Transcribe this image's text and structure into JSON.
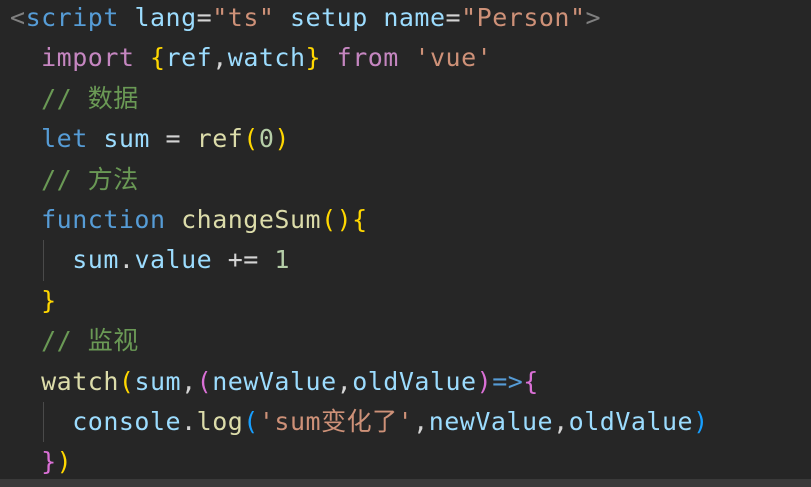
{
  "editor": {
    "lines": [
      {
        "tokens": [
          {
            "t": "<",
            "c": "tag-bracket"
          },
          {
            "t": "script",
            "c": "tag-name"
          },
          {
            "t": " ",
            "c": "punct"
          },
          {
            "t": "lang",
            "c": "attr-name"
          },
          {
            "t": "=",
            "c": "attr-eq"
          },
          {
            "t": "\"ts\"",
            "c": "string"
          },
          {
            "t": " ",
            "c": "punct"
          },
          {
            "t": "setup",
            "c": "attr-name"
          },
          {
            "t": " ",
            "c": "punct"
          },
          {
            "t": "name",
            "c": "attr-name"
          },
          {
            "t": "=",
            "c": "attr-eq"
          },
          {
            "t": "\"Person\"",
            "c": "string"
          },
          {
            "t": ">",
            "c": "tag-bracket"
          }
        ]
      },
      {
        "tokens": [
          {
            "t": "  ",
            "c": "punct"
          },
          {
            "t": "import",
            "c": "keyword-flow"
          },
          {
            "t": " ",
            "c": "punct"
          },
          {
            "t": "{",
            "c": "brace1"
          },
          {
            "t": "ref",
            "c": "variable"
          },
          {
            "t": ",",
            "c": "punct"
          },
          {
            "t": "watch",
            "c": "variable"
          },
          {
            "t": "}",
            "c": "brace1"
          },
          {
            "t": " ",
            "c": "punct"
          },
          {
            "t": "from",
            "c": "keyword-flow"
          },
          {
            "t": " ",
            "c": "punct"
          },
          {
            "t": "'vue'",
            "c": "string"
          }
        ]
      },
      {
        "tokens": [
          {
            "t": "  ",
            "c": "punct"
          },
          {
            "t": "// 数据",
            "c": "comment"
          }
        ]
      },
      {
        "tokens": [
          {
            "t": "  ",
            "c": "punct"
          },
          {
            "t": "let",
            "c": "keyword"
          },
          {
            "t": " ",
            "c": "punct"
          },
          {
            "t": "sum",
            "c": "variable"
          },
          {
            "t": " = ",
            "c": "punct"
          },
          {
            "t": "ref",
            "c": "function"
          },
          {
            "t": "(",
            "c": "brace1"
          },
          {
            "t": "0",
            "c": "number"
          },
          {
            "t": ")",
            "c": "brace1"
          }
        ]
      },
      {
        "tokens": [
          {
            "t": "  ",
            "c": "punct"
          },
          {
            "t": "// 方法",
            "c": "comment"
          }
        ]
      },
      {
        "tokens": [
          {
            "t": "  ",
            "c": "punct"
          },
          {
            "t": "function",
            "c": "keyword"
          },
          {
            "t": " ",
            "c": "punct"
          },
          {
            "t": "changeSum",
            "c": "function"
          },
          {
            "t": "()",
            "c": "brace1"
          },
          {
            "t": "{",
            "c": "brace1"
          }
        ]
      },
      {
        "guide": true,
        "tokens": [
          {
            "t": "    ",
            "c": "punct"
          },
          {
            "t": "sum",
            "c": "variable"
          },
          {
            "t": ".",
            "c": "punct"
          },
          {
            "t": "value",
            "c": "variable"
          },
          {
            "t": " += ",
            "c": "punct"
          },
          {
            "t": "1",
            "c": "number"
          }
        ]
      },
      {
        "tokens": [
          {
            "t": "  ",
            "c": "punct"
          },
          {
            "t": "}",
            "c": "brace1"
          }
        ]
      },
      {
        "tokens": [
          {
            "t": "  ",
            "c": "punct"
          },
          {
            "t": "// 监视",
            "c": "comment"
          }
        ]
      },
      {
        "tokens": [
          {
            "t": "  ",
            "c": "punct"
          },
          {
            "t": "watch",
            "c": "function"
          },
          {
            "t": "(",
            "c": "brace1"
          },
          {
            "t": "sum",
            "c": "variable"
          },
          {
            "t": ",",
            "c": "punct"
          },
          {
            "t": "(",
            "c": "brace2"
          },
          {
            "t": "newValue",
            "c": "variable"
          },
          {
            "t": ",",
            "c": "punct"
          },
          {
            "t": "oldValue",
            "c": "variable"
          },
          {
            "t": ")",
            "c": "brace2"
          },
          {
            "t": "=>",
            "c": "keyword"
          },
          {
            "t": "{",
            "c": "brace2"
          }
        ]
      },
      {
        "guide": true,
        "tokens": [
          {
            "t": "    ",
            "c": "punct"
          },
          {
            "t": "console",
            "c": "variable"
          },
          {
            "t": ".",
            "c": "punct"
          },
          {
            "t": "log",
            "c": "function"
          },
          {
            "t": "(",
            "c": "brace3"
          },
          {
            "t": "'sum变化了'",
            "c": "string"
          },
          {
            "t": ",",
            "c": "punct"
          },
          {
            "t": "newValue",
            "c": "variable"
          },
          {
            "t": ",",
            "c": "punct"
          },
          {
            "t": "oldValue",
            "c": "variable"
          },
          {
            "t": ")",
            "c": "brace3"
          }
        ]
      },
      {
        "tokens": [
          {
            "t": "  ",
            "c": "punct"
          },
          {
            "t": "}",
            "c": "brace2"
          },
          {
            "t": ")",
            "c": "brace1"
          }
        ]
      }
    ]
  }
}
